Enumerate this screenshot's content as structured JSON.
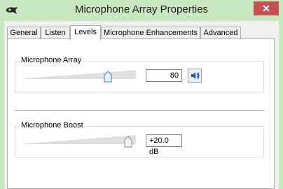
{
  "window": {
    "title": "Microphone Array Properties",
    "close_label": "✕",
    "accent_color": "#c9e7c1"
  },
  "tabs": [
    {
      "label": "General"
    },
    {
      "label": "Listen"
    },
    {
      "label": "Levels"
    },
    {
      "label": "Microphone Enhancements"
    },
    {
      "label": "Advanced"
    }
  ],
  "active_tab": "Levels",
  "levels": {
    "microphone_array": {
      "label": "Microphone Array",
      "value": "80",
      "level_percent": 80,
      "mute_icon": "speaker-icon"
    },
    "microphone_boost": {
      "label": "Microphone Boost",
      "value": "+20.0 dB",
      "level_percent": 100
    }
  }
}
